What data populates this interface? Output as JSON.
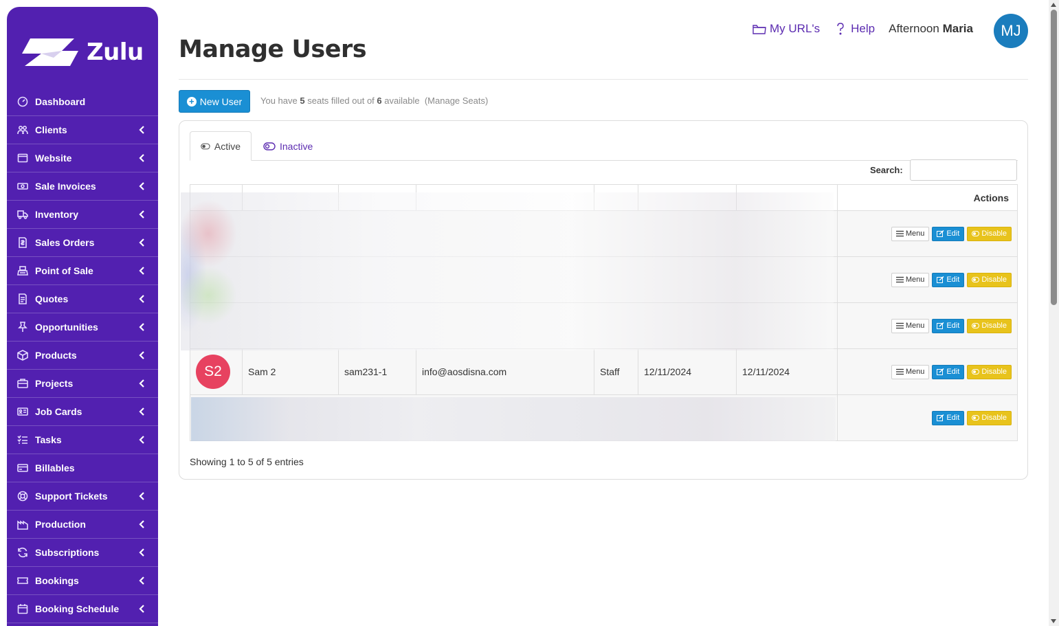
{
  "brand": {
    "name": "Zulu"
  },
  "sidebar": {
    "items": [
      {
        "label": "Dashboard",
        "icon": "dashboard-icon",
        "has_submenu": false
      },
      {
        "label": "Clients",
        "icon": "clients-icon",
        "has_submenu": true
      },
      {
        "label": "Website",
        "icon": "website-icon",
        "has_submenu": true
      },
      {
        "label": "Sale Invoices",
        "icon": "invoice-icon",
        "has_submenu": true
      },
      {
        "label": "Inventory",
        "icon": "truck-icon",
        "has_submenu": true
      },
      {
        "label": "Sales Orders",
        "icon": "sales-order-icon",
        "has_submenu": true
      },
      {
        "label": "Point of Sale",
        "icon": "register-icon",
        "has_submenu": true
      },
      {
        "label": "Quotes",
        "icon": "quote-icon",
        "has_submenu": true
      },
      {
        "label": "Opportunities",
        "icon": "pin-icon",
        "has_submenu": true
      },
      {
        "label": "Products",
        "icon": "box-icon",
        "has_submenu": true
      },
      {
        "label": "Projects",
        "icon": "briefcase-icon",
        "has_submenu": true
      },
      {
        "label": "Job Cards",
        "icon": "id-card-icon",
        "has_submenu": true
      },
      {
        "label": "Tasks",
        "icon": "list-icon",
        "has_submenu": true
      },
      {
        "label": "Billables",
        "icon": "card-icon",
        "has_submenu": false
      },
      {
        "label": "Support Tickets",
        "icon": "lifebuoy-icon",
        "has_submenu": true
      },
      {
        "label": "Production",
        "icon": "factory-icon",
        "has_submenu": true
      },
      {
        "label": "Subscriptions",
        "icon": "refresh-icon",
        "has_submenu": true
      },
      {
        "label": "Bookings",
        "icon": "ticket-icon",
        "has_submenu": true
      },
      {
        "label": "Booking Schedule",
        "icon": "calendar-icon",
        "has_submenu": true
      }
    ]
  },
  "header": {
    "title": "Manage Users",
    "my_urls": "My URL's",
    "help": "Help",
    "greeting_prefix": "Afternoon",
    "greeting_name": "Maria",
    "avatar_initials": "MJ"
  },
  "toolbar": {
    "new_user_label": "New User",
    "seats_prefix": "You have",
    "seats_filled": "5",
    "seats_mid": "seats filled out of",
    "seats_total": "6",
    "seats_suffix": "available",
    "manage_seats": "(Manage Seats)"
  },
  "tabs": {
    "active": "Active",
    "inactive": "Inactive"
  },
  "search": {
    "label": "Search:",
    "value": ""
  },
  "table": {
    "actions_header": "Actions",
    "rows": [
      {
        "redacted": true,
        "has_menu": true
      },
      {
        "redacted": true,
        "has_menu": true
      },
      {
        "redacted": true,
        "has_menu": true
      },
      {
        "redacted": false,
        "has_menu": true,
        "initials": "S2",
        "name": "Sam 2",
        "username": "sam231-1",
        "email": "info@aosdisna.com",
        "role": "Staff",
        "date1": "12/11/2024",
        "date2": "12/11/2024"
      },
      {
        "redacted": true,
        "has_menu": false
      }
    ],
    "buttons": {
      "menu": "Menu",
      "edit": "Edit",
      "disable": "Disable"
    },
    "showing": "Showing 1 to 5 of 5 entries"
  },
  "colors": {
    "sidebar": "#5220b0",
    "primary": "#1a8fd4",
    "warning": "#e8c31c",
    "link": "#5b2bb0",
    "row_avatar": "#e74260",
    "user_avatar": "#1b7dbd"
  }
}
